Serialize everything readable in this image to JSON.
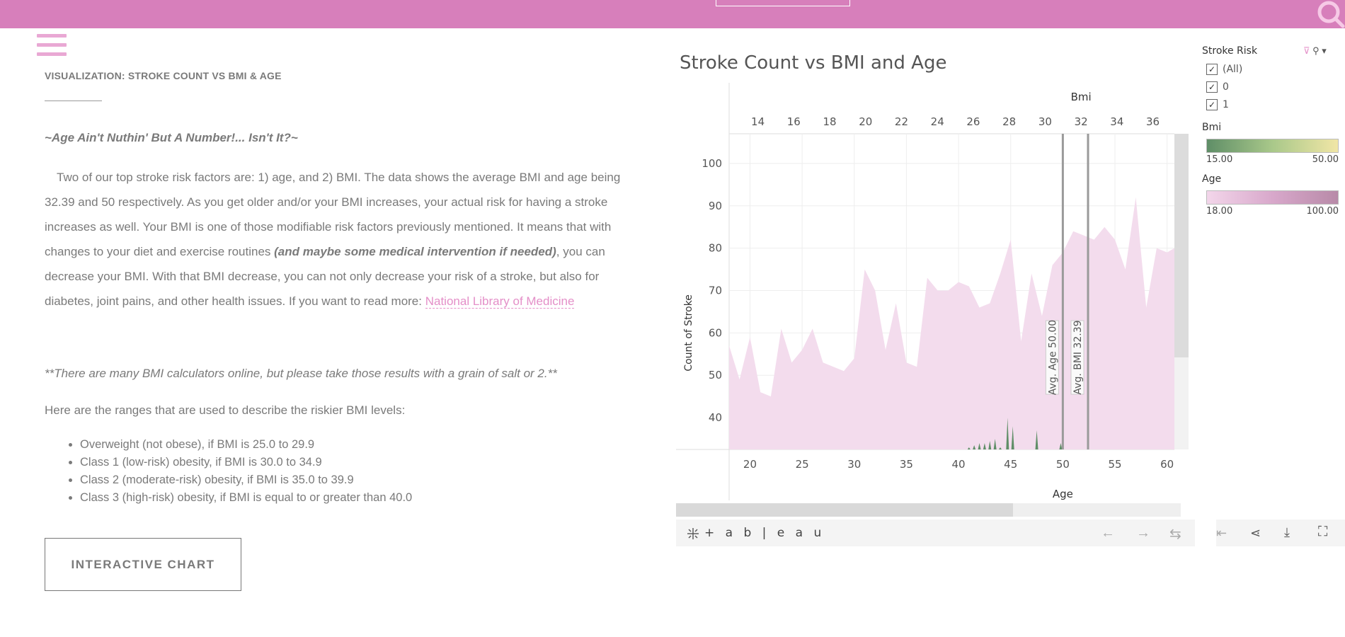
{
  "header": {
    "menu_icon": "hamburger-icon",
    "search_icon": "search-icon",
    "bar_color": "#d77fbb"
  },
  "article": {
    "section_title": "VISUALIZATION: STROKE COUNT VS BMI & AGE",
    "tagline": "~Age Ain't Nuthin' But A Number!... Isn't It?~",
    "para_part1": "Two of our top stroke risk factors are: 1) age, and 2) BMI. The data shows the average BMI and age being 32.39 and 50 respectively. As you get older and/or your BMI increases, your actual risk for having a stroke increases as well. Your BMI is one of those modifiable risk factors previously mentioned. It means that with changes to your diet and exercise routines ",
    "para_italic": "(and maybe some medical intervention if needed)",
    "para_part2": ", you can decrease your BMI. With that BMI decrease, you can not only decrease your risk of a stroke, but also for diabetes, joint pains, and other health issues. If you want to read more: ",
    "link_text": "National Library of Medicine",
    "note": "**There are many BMI calculators online, but please take those results with a grain of salt or 2.**",
    "ranges_intro": "Here are the ranges that are used to describe the riskier BMI levels:",
    "ranges": [
      "Overweight (not obese), if BMI is 25.0 to 29.9",
      "Class 1 (low-risk) obesity, if BMI is 30.0 to 34.9",
      "Class 2 (moderate-risk) obesity, if BMI is 35.0 to 39.9",
      "Class 3 (high-risk) obesity, if BMI is equal to or greater than 40.0"
    ],
    "button_label": "INTERACTIVE CHART"
  },
  "viz": {
    "title": "Stroke Count vs BMI and Age",
    "legend": {
      "stroke_risk_title": "Stroke Risk",
      "stroke_risk_items": [
        "(All)",
        "0",
        "1"
      ],
      "bmi_title": "Bmi",
      "bmi_min": "15.00",
      "bmi_max": "50.00",
      "age_title": "Age",
      "age_min": "18.00",
      "age_max": "100.00"
    },
    "toolbar": {
      "logo": "+ a b | e a u"
    }
  },
  "chart_data": {
    "type": "area",
    "title": "Stroke Count vs BMI and Age",
    "top_axis": {
      "label": "Bmi",
      "ticks": [
        14,
        16,
        18,
        20,
        22,
        24,
        26,
        28,
        30,
        32,
        34,
        36
      ],
      "range": [
        12.4,
        37.2
      ]
    },
    "x_axis": {
      "label": "Age",
      "ticks": [
        20,
        25,
        30,
        35,
        40,
        45,
        50,
        55,
        60
      ],
      "range": [
        18,
        60.7
      ]
    },
    "y_axis": {
      "label": "Count of Stroke",
      "ticks": [
        40,
        50,
        60,
        70,
        80,
        90,
        100
      ],
      "range": [
        32.5,
        107
      ]
    },
    "grid": true,
    "reference_lines": [
      {
        "label": "Avg. Age 50.00",
        "axis": "age",
        "value": 50
      },
      {
        "label": "Avg. BMI 32.39",
        "axis": "bmi",
        "value": 32.39
      }
    ],
    "series": [
      {
        "name": "0",
        "x": [
          18,
          19,
          20,
          21,
          22,
          23,
          24,
          25,
          26,
          27,
          28,
          29,
          30,
          31,
          32,
          33,
          34,
          35,
          36,
          37,
          38,
          39,
          40,
          41,
          42,
          43,
          44,
          45,
          46,
          47,
          48,
          49,
          50,
          51,
          52,
          53,
          54,
          55,
          56,
          57,
          58,
          59,
          60,
          60.7
        ],
        "values": [
          57,
          49,
          59,
          46,
          45,
          61,
          53,
          56,
          61,
          53,
          52,
          51,
          54,
          75,
          70,
          56,
          67,
          53,
          52,
          73,
          70,
          70,
          72,
          71,
          66,
          67,
          74,
          82,
          58,
          74,
          64,
          76,
          79,
          84,
          83,
          82,
          85,
          82,
          75,
          92,
          66,
          80,
          79,
          80
        ]
      },
      {
        "name": "1",
        "spikes": [
          [
            41,
            33
          ],
          [
            41.5,
            33.5
          ],
          [
            42,
            34
          ],
          [
            42.5,
            34
          ],
          [
            43,
            34.5
          ],
          [
            43.5,
            35
          ],
          [
            44,
            33
          ],
          [
            44.7,
            40
          ],
          [
            45.2,
            38
          ],
          [
            45.7,
            32.5
          ],
          [
            47.5,
            37
          ],
          [
            49.8,
            34
          ]
        ]
      }
    ],
    "colors": {
      "area_fill": "#f3dced",
      "spikes": "#5f8e67",
      "ref_line": "#9a9a9a"
    }
  }
}
